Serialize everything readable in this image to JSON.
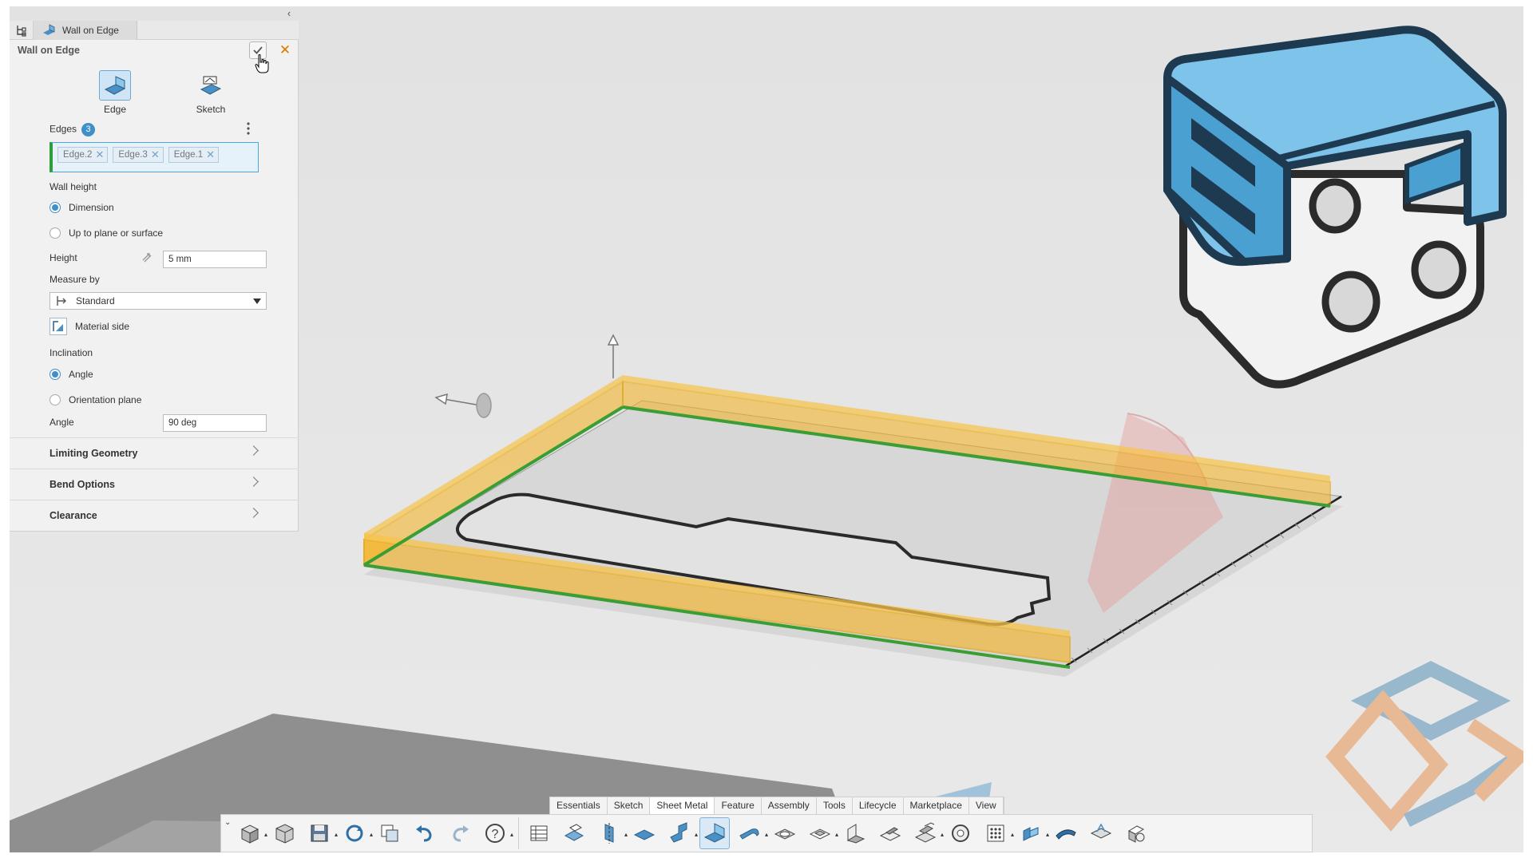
{
  "panel": {
    "tab_label": "Wall on Edge",
    "title": "Wall on Edge",
    "modes": [
      {
        "label": "Edge",
        "icon": "wall-on-edge-icon",
        "active": true
      },
      {
        "label": "Sketch",
        "icon": "sketch-wall-icon",
        "active": false
      }
    ],
    "edges": {
      "label": "Edges",
      "count": "3",
      "chips": [
        "Edge.2",
        "Edge.3",
        "Edge.1"
      ]
    },
    "wall_height": {
      "label": "Wall height",
      "options": [
        "Dimension",
        "Up to plane or surface"
      ],
      "selected": "Dimension"
    },
    "height": {
      "label": "Height",
      "value": "5 mm"
    },
    "measure_by": {
      "label": "Measure by",
      "value": "Standard"
    },
    "material_side": "Material side",
    "inclination": {
      "label": "Inclination",
      "options": [
        "Angle",
        "Orientation plane"
      ],
      "selected": "Angle"
    },
    "angle": {
      "label": "Angle",
      "value": "90 deg"
    },
    "sections": [
      "Limiting Geometry",
      "Bend Options",
      "Clearance"
    ]
  },
  "toolbar": {
    "tabs": [
      "Essentials",
      "Sketch",
      "Sheet Metal",
      "Feature",
      "Assembly",
      "Tools",
      "Lifecycle",
      "Marketplace",
      "View"
    ],
    "active_tab": "Sheet Metal"
  },
  "colors": {
    "selection_orange": "#f5b21d",
    "edge_green": "#3a9e35",
    "accent_blue": "#3f8fc8",
    "logo_blue": "#4aa0d0",
    "watermark_orange": "#e8a06a",
    "watermark_blue": "#6f9fbf"
  }
}
